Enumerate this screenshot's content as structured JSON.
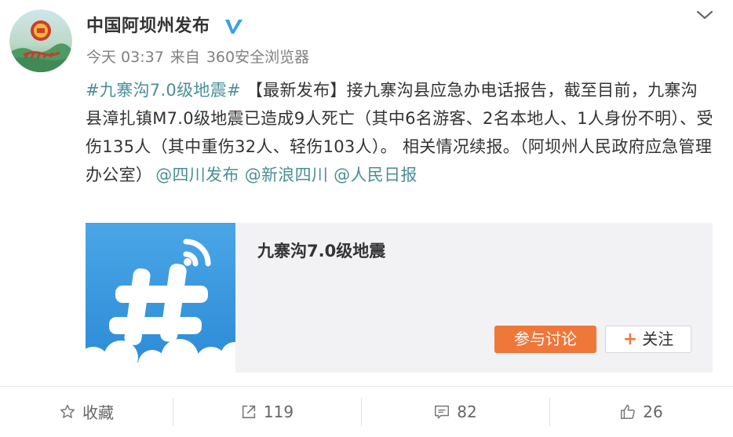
{
  "author": {
    "name": "中国阿坝州发布",
    "avatar_icon": "government-emblem-avatar",
    "verified_icon": "verified-v-icon"
  },
  "meta": {
    "time": "今天 03:37",
    "source_prefix": "来自",
    "source": "360安全浏览器"
  },
  "post": {
    "hashtag": "#九寨沟7.0级地震#",
    "text_main": " 【最新发布】接九寨沟县应急办电话报告，截至目前，九寨沟县漳扎镇M7.0级地震已造成9人死亡（其中6名游客、2名本地人、1人身份不明）、受伤135人（其中重伤32人、轻伤103人）。 相关情况续报。（阿坝州人民政府应急管理办公室）",
    "mentions": [
      "@四川发布",
      "@新浪四川",
      "@人民日报"
    ]
  },
  "card": {
    "title": "九寨沟7.0级地震",
    "thumb_icon": "hashtag-topic-icon",
    "join_button": "参与讨论",
    "follow_button": "关注"
  },
  "actions": {
    "favorite_label": "收藏",
    "repost_count": "119",
    "comment_count": "82",
    "like_count": "26"
  },
  "colors": {
    "link": "#4a8f96",
    "accent_orange": "#f0773a",
    "meta_gray": "#808080"
  }
}
